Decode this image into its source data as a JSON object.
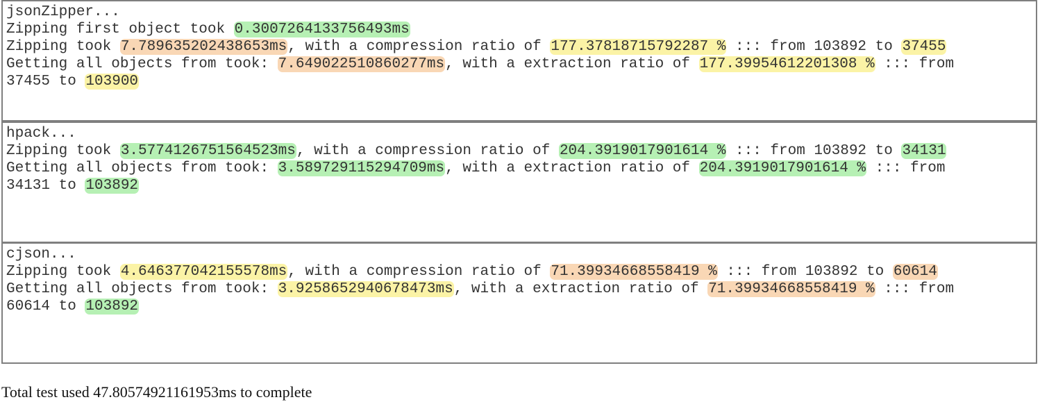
{
  "panels": [
    {
      "lines": [
        [
          {
            "text": "jsonZipper..."
          }
        ],
        [
          {
            "text": "Zipping first object took "
          },
          {
            "text": "0.3007264133756493ms",
            "hl": "green"
          }
        ],
        [
          {
            "text": "Zipping took "
          },
          {
            "text": "7.789635202438653ms",
            "hl": "orange"
          },
          {
            "text": ", with a compression ratio of "
          },
          {
            "text": "177.37818715792287 %",
            "hl": "yellow"
          },
          {
            "text": " ::: from 103892 to "
          },
          {
            "text": "37455",
            "hl": "yellow"
          }
        ],
        [
          {
            "text": "Getting all objects from took: "
          },
          {
            "text": "7.649022510860277ms",
            "hl": "orange"
          },
          {
            "text": ", with a extraction ratio of "
          },
          {
            "text": "177.39954612201308 %",
            "hl": "yellow"
          },
          {
            "text": " ::: from"
          }
        ],
        [
          {
            "text": "37455 to "
          },
          {
            "text": "103900",
            "hl": "yellow"
          }
        ]
      ]
    },
    {
      "lines": [
        [
          {
            "text": "hpack..."
          }
        ],
        [
          {
            "text": "Zipping took "
          },
          {
            "text": "3.5774126751564523ms",
            "hl": "green"
          },
          {
            "text": ", with a compression ratio of "
          },
          {
            "text": "204.3919017901614 %",
            "hl": "green"
          },
          {
            "text": " ::: from 103892 to "
          },
          {
            "text": "34131",
            "hl": "green"
          }
        ],
        [
          {
            "text": "Getting all objects from took: "
          },
          {
            "text": "3.589729115294709ms",
            "hl": "green"
          },
          {
            "text": ", with a extraction ratio of "
          },
          {
            "text": "204.3919017901614 %",
            "hl": "green"
          },
          {
            "text": " ::: from"
          }
        ],
        [
          {
            "text": "34131 to "
          },
          {
            "text": "103892",
            "hl": "green"
          }
        ]
      ]
    },
    {
      "lines": [
        [
          {
            "text": "cjson..."
          }
        ],
        [
          {
            "text": "Zipping took "
          },
          {
            "text": "4.646377042155578ms",
            "hl": "yellow"
          },
          {
            "text": ", with a compression ratio of "
          },
          {
            "text": "71.39934668558419 %",
            "hl": "orange"
          },
          {
            "text": " ::: from 103892 to "
          },
          {
            "text": "60614",
            "hl": "orange"
          }
        ],
        [
          {
            "text": "Getting all objects from took: "
          },
          {
            "text": "3.9258652940678473ms",
            "hl": "yellow"
          },
          {
            "text": ", with a extraction ratio of "
          },
          {
            "text": "71.39934668558419 %",
            "hl": "orange"
          },
          {
            "text": " ::: from"
          }
        ],
        [
          {
            "text": "60614 to "
          },
          {
            "text": "103892",
            "hl": "green"
          }
        ]
      ]
    }
  ],
  "footer": {
    "text": "Total test used 47.80574921161953ms to complete"
  },
  "colors": {
    "green": "#b6f0b4",
    "orange": "#f9d7b5",
    "yellow": "#fbf3a6",
    "border": "#7f7f7f",
    "console_text": "#333333"
  }
}
